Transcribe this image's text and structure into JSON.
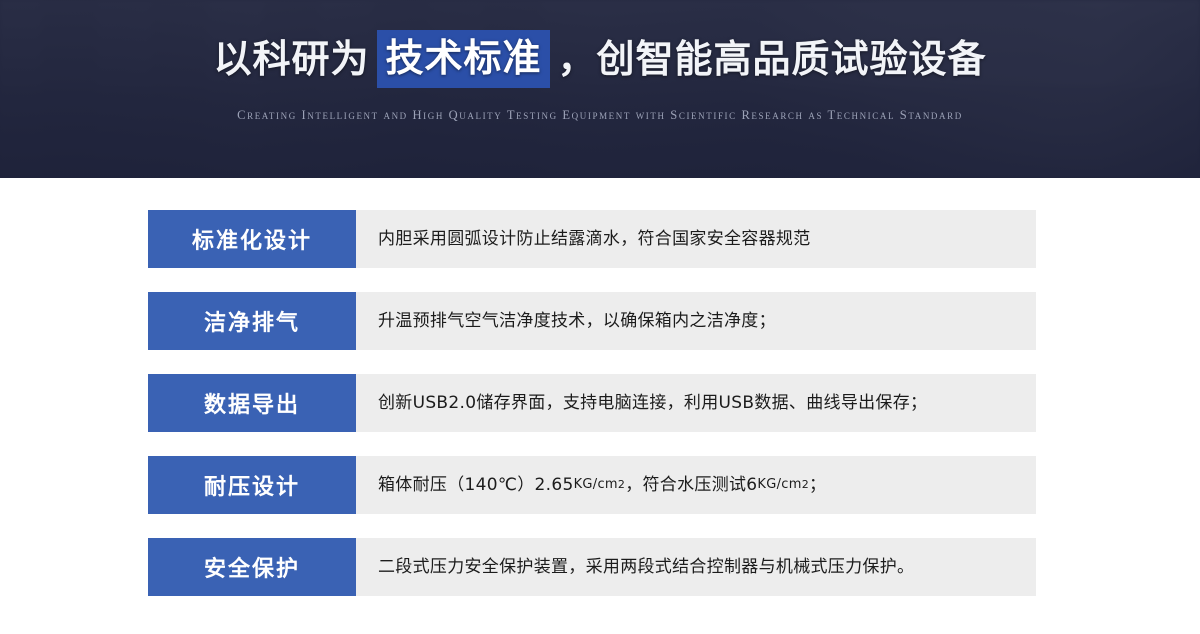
{
  "banner": {
    "title_pre": "以科研为",
    "title_highlight": "技术标准",
    "title_post": "，创智能高品质试验设备",
    "subtitle": "Creating Intelligent and High Quality Testing Equipment with Scientific Research as Technical Standard",
    "colors": {
      "background": "#22263c",
      "overlay": "#262a42",
      "highlight": "#2b4fa8",
      "title_text": "#f2f4f8",
      "subtitle_text": "#9da3b8"
    }
  },
  "features": {
    "colors": {
      "label_bg": "#3a62b4",
      "label_text": "#ffffff",
      "desc_bg": "#ededed",
      "desc_text": "#1c1c1c"
    },
    "rows": [
      {
        "label": "标准化设计",
        "desc": "内胆采用圆弧设计防止结露滴水，符合国家安全容器规范"
      },
      {
        "label": "洁净排气",
        "desc": "升温预排气空气洁净度技术，以确保箱内之洁净度；"
      },
      {
        "label": "数据导出",
        "desc": "创新USB2.0储存界面，支持电脑连接，利用USB数据、曲线导出保存；"
      },
      {
        "label": "耐压设计",
        "desc_parts": {
          "p1": "箱体耐压（140℃）2.65",
          "unit1": "KG/cm",
          "sup1": "2",
          "p2": "，符合水压测试6",
          "unit2": "KG/cm",
          "sup2": "2",
          "p3": "；"
        }
      },
      {
        "label": "安全保护",
        "desc": "二段式压力安全保护装置，采用两段式结合控制器与机械式压力保护。"
      }
    ]
  }
}
